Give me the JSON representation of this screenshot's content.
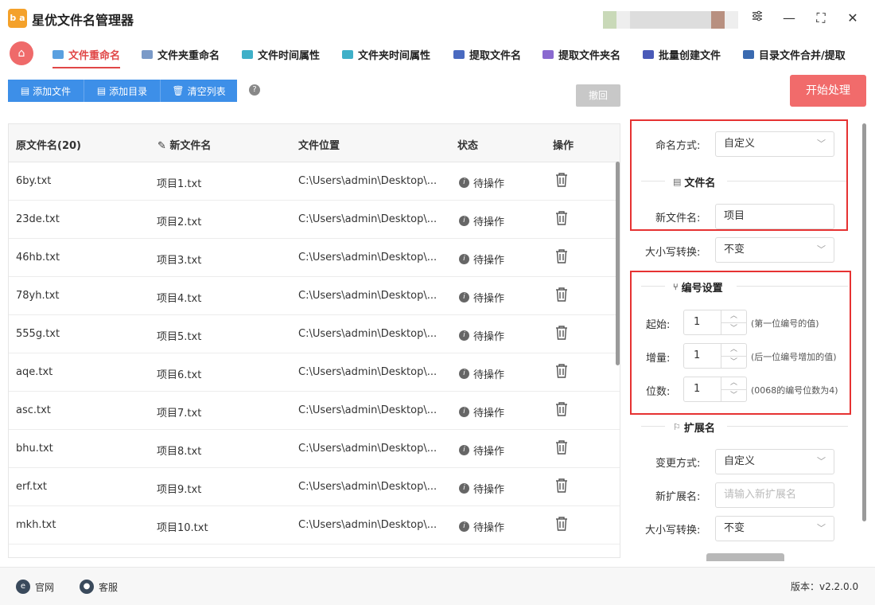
{
  "app": {
    "title": "星优文件名管理器",
    "logo_text": "b a"
  },
  "window": {
    "settings_icon": "sliders-icon",
    "min": "—",
    "max": "⛶",
    "close": "✕"
  },
  "tabs": [
    {
      "label": "文件重命名",
      "color": "#5aa0e0"
    },
    {
      "label": "文件夹重命名",
      "color": "#7a9ac8"
    },
    {
      "label": "文件时间属性",
      "color": "#3fb0c8"
    },
    {
      "label": "文件夹时间属性",
      "color": "#3fb0c8"
    },
    {
      "label": "提取文件名",
      "color": "#4a6ac0"
    },
    {
      "label": "提取文件夹名",
      "color": "#8a6ad0"
    },
    {
      "label": "批量创建文件",
      "color": "#4a5ab8"
    },
    {
      "label": "目录文件合并/提取",
      "color": "#3a6ab0"
    }
  ],
  "toolbar": {
    "add_file": "添加文件",
    "add_dir": "添加目录",
    "clear": "清空列表",
    "help": "?",
    "undo": "撤回",
    "start": "开始处理"
  },
  "table": {
    "headers": {
      "orig": "原文件名(20)",
      "new": "新文件名",
      "location": "文件位置",
      "status": "状态",
      "action": "操作"
    },
    "rows": [
      {
        "orig": "6by.txt",
        "new": "项目1.txt",
        "location": "C:\\Users\\admin\\Desktop\\...",
        "status": "待操作"
      },
      {
        "orig": "23de.txt",
        "new": "项目2.txt",
        "location": "C:\\Users\\admin\\Desktop\\...",
        "status": "待操作"
      },
      {
        "orig": "46hb.txt",
        "new": "项目3.txt",
        "location": "C:\\Users\\admin\\Desktop\\...",
        "status": "待操作"
      },
      {
        "orig": "78yh.txt",
        "new": "项目4.txt",
        "location": "C:\\Users\\admin\\Desktop\\...",
        "status": "待操作"
      },
      {
        "orig": "555g.txt",
        "new": "项目5.txt",
        "location": "C:\\Users\\admin\\Desktop\\...",
        "status": "待操作"
      },
      {
        "orig": "aqe.txt",
        "new": "项目6.txt",
        "location": "C:\\Users\\admin\\Desktop\\...",
        "status": "待操作"
      },
      {
        "orig": "asc.txt",
        "new": "项目7.txt",
        "location": "C:\\Users\\admin\\Desktop\\...",
        "status": "待操作"
      },
      {
        "orig": "bhu.txt",
        "new": "项目8.txt",
        "location": "C:\\Users\\admin\\Desktop\\...",
        "status": "待操作"
      },
      {
        "orig": "erf.txt",
        "new": "项目9.txt",
        "location": "C:\\Users\\admin\\Desktop\\...",
        "status": "待操作"
      },
      {
        "orig": "mkh.txt",
        "new": "项目10.txt",
        "location": "C:\\Users\\admin\\Desktop\\...",
        "status": "待操作"
      }
    ]
  },
  "panel": {
    "naming_mode_label": "命名方式:",
    "naming_mode_value": "自定义",
    "filename_section": "文件名",
    "new_name_label": "新文件名:",
    "new_name_value": "项目",
    "case_label": "大小写转换:",
    "case_value": "不变",
    "numbering_section": "编号设置",
    "start_label": "起始:",
    "start_value": "1",
    "start_hint": "(第一位编号的值)",
    "step_label": "增量:",
    "step_value": "1",
    "step_hint": "(后一位编号增加的值)",
    "digits_label": "位数:",
    "digits_value": "1",
    "digits_hint": "(0068的编号位数为4)",
    "ext_section": "扩展名",
    "ext_mode_label": "变更方式:",
    "ext_mode_value": "自定义",
    "new_ext_label": "新扩展名:",
    "new_ext_placeholder": "请输入新扩展名",
    "ext_case_label": "大小写转换:",
    "ext_case_value": "不变"
  },
  "footer": {
    "website": "官网",
    "service": "客服",
    "version": "版本：v2.2.0.0"
  }
}
